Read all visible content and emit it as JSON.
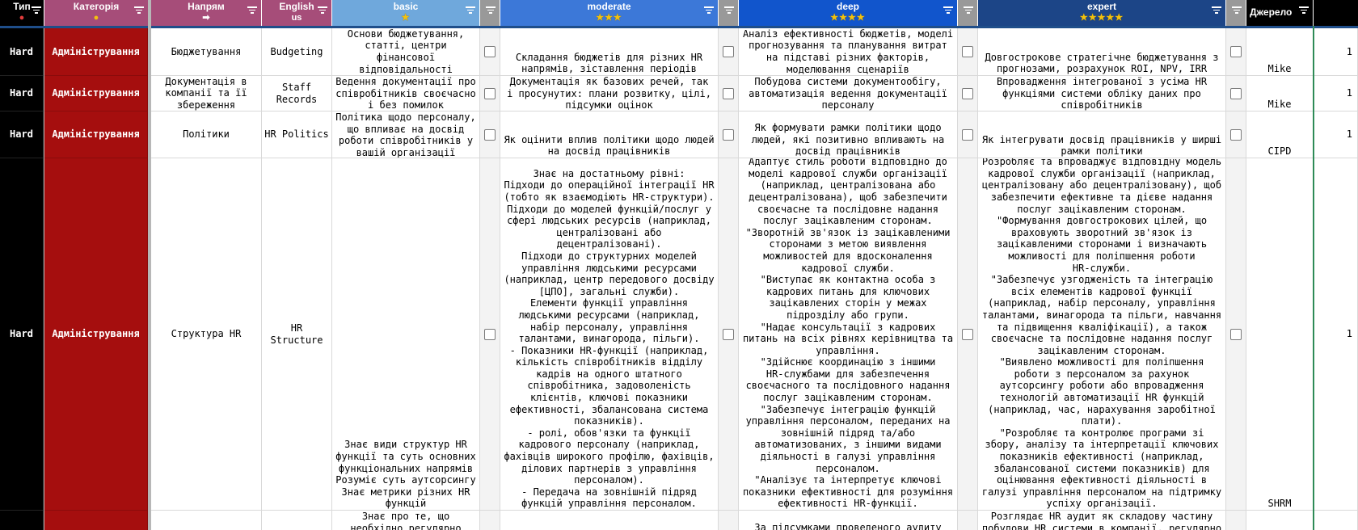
{
  "headers": {
    "type": "Тип",
    "category": "Категорія",
    "direction": "Напрям",
    "english": "English",
    "english_sub": "us",
    "basic": "basic",
    "moderate": "moderate",
    "deep": "deep",
    "expert": "expert",
    "source": "Джерело",
    "basic_stars": "★",
    "moderate_stars": "★★★",
    "deep_stars": "★★★★",
    "expert_stars": "★★★★★"
  },
  "colors": {
    "type_header": "#000000",
    "category_header": "#a64d79",
    "direction_header": "#a64d79",
    "english_header": "#a64d79",
    "basic_header": "#6fa8dc",
    "moderate_header": "#3c78d8",
    "deep_header": "#1155cc",
    "expert_header": "#1c4587",
    "source_header": "#000000",
    "category_cell": "#a50e0e"
  },
  "rows": [
    {
      "type": "Hard",
      "category": "Адміністрування",
      "direction": "Бюджетування",
      "english": "Budgeting",
      "basic": "Основи бюджетування,\nстатті, центри\nфінансової\nвідповідальності",
      "moderate": "Складання бюджетів для різних HR\nнапрямів, зіставлення періодів",
      "deep": "Аналіз ефективності бюджетів, моделі\nпрогнозування та планування витрат\nна підставі різних факторів,\nмоделювання сценаріїв",
      "expert": "Довгострокове стратегічне бюджетування з\nпрогнозами, розрахунок ROI, NPV, IRR",
      "source": "Mike",
      "count": "1"
    },
    {
      "type": "Hard",
      "category": "Адміністрування",
      "direction": "Документація в\nкомпанії та її\nзбереження",
      "english": "Staff\nRecords",
      "basic": "Ведення документації про\nспівробітників своєчасно\nі без помилок",
      "moderate": "Документація як базових речей, так\nі просунутих: плани розвитку, цілі,\nпідсумки оцінок",
      "deep": "Побудова системи документообігу,\nавтоматизація ведення документації\nперсоналу",
      "expert": "Впровадження інтегрованої з усіма HR\nфункціями системи обліку даних про\nспівробітників",
      "source": "Mike",
      "count": "1"
    },
    {
      "type": "Hard",
      "category": "Адміністрування",
      "direction": "Політики",
      "english": "HR Politics",
      "basic": "Політика щодо персоналу,\nщо впливає на досвід\nроботи співробітників у\nвашій організації",
      "moderate": "Як оцінити вплив політики щодо людей\nна досвід працівників",
      "deep": "Як формувати рамки політики щодо\nлюдей, які позитивно впливають на\nдосвід працівників",
      "expert": "Як інтегрувати досвід працівників у ширші\nрамки політики",
      "source": "CIPD",
      "count": "1"
    },
    {
      "type": "Hard",
      "category": "Адміністрування",
      "direction": "Структура HR",
      "english": "HR\nStructure",
      "basic": "Знає види структур HR\nфункції та суть основних\nфункціональних напрямів\nРозуміє суть аутсорсингу\nЗнає метрики різних HR\nфункцій",
      "moderate": "Знає на достатньому рівні:\nПідходи до операційної інтеграції HR\n(тобто як взаємодіють HR-структури).\nПідходи до моделей функцій/послуг у\nсфері людських ресурсів (наприклад,\nцентралізовані або\nдецентралізовані).\nПідходи до структурних моделей\nуправління людськими ресурсами\n(наприклад, центр передового досвіду\n[ЦПО], загальні служби).\nЕлементи функції управління\nлюдськими ресурсами (наприклад,\nнабір персоналу, управління\nталантами, винагорода, пільги).\n- Показники HR-функції (наприклад,\nкількість співробітників відділу\nкадрів на одного штатного\nспівробітника, задоволеність\nклієнтів, ключові показники\nефективності, збалансована система\nпоказників).\n- ролі, обов'язки та функції\nкадрового персоналу (наприклад,\nфахівців широкого профілю, фахівців,\nділових партнерів з управління\nперсоналом).\n- Передача на зовнішній підряд\nфункцій управління персоналом.",
      "deep": "Адаптує стиль роботи відповідно до\nмоделі кадрової служби організації\n(наприклад, централізована або\nдецентралізована), щоб забезпечити\nсвоєчасне та послідовне надання\nпослуг зацікавленим сторонам.\n\"Зворотній зв'язок із зацікавленими\nсторонами з метою виявлення\nможливостей для вдосконалення\nкадрової служби.\n\"Виступає як контактна особа з\nкадрових питань для ключових\nзацікавлених сторін у межах\nпідрозділу або групи.\n\"Надає консультації з кадрових\nпитань на всіх рівнях керівництва та\nуправління.\n\"Здійснює координацію з іншими\nHR-службами для забезпечення\nсвоєчасного та послідовного надання\nпослуг зацікавленим сторонам.\n\"Забезпечує інтеграцію функцій\nуправління персоналом, переданих на\nзовнішній підряд та/або\nавтоматизованих, з іншими видами\nдіяльності в галузі управління\nперсоналом.\n\"Аналізує та інтерпретує ключові\nпоказники ефективності для розуміння\nефективності HR-функції.",
      "expert": "Розробляє та впроваджує відповідну модель\nкадрової служби організації (наприклад,\nцентралізовану або децентралізовану), щоб\nзабезпечити ефективне та дієве надання\nпослуг зацікавленим сторонам.\n\"Формування довгострокових цілей, що\nвраховують зворотний зв'язок із\nзацікавленими сторонами і визначають\nможливості для поліпшення роботи\nHR-служби.\n\"Забезпечує узгодженість та інтеграцію\nвсіх елементів кадрової функції\n(наприклад, набір персоналу, управління\nталантами, винагорода та пільги, навчання\nта підвищення кваліфікації), а також\nсвоєчасне та послідовне надання послуг\nзацікавленим сторонам.\n\"Виявлено можливості для поліпшення\nроботи з персоналом за рахунок\nаутсорсингу роботи або впровадження\nтехнологій автоматизації HR функцій\n(наприклад, час, нарахування заробітної\nплати).\n\"Розробляє та контролює програми зі\nзбору, аналізу та інтерпретації ключових\nпоказників ефективності (наприклад,\nзбалансованої системи показників) для\nоцінювання ефективності діяльності в\nгалузі управління персоналом на підтримку\nуспіху організації.",
      "source": "SHRM",
      "count": "1"
    },
    {
      "type": "",
      "category": "",
      "direction": "",
      "english": "",
      "basic": "Знає про те, що\nнеобхідно регулярно",
      "moderate": "",
      "deep": "За підсумками проведеного аудиту",
      "expert": "Розглядає HR аудит як складову частину\nпобудови HR системи в компанії, регулярно",
      "source": "",
      "count": ""
    }
  ]
}
